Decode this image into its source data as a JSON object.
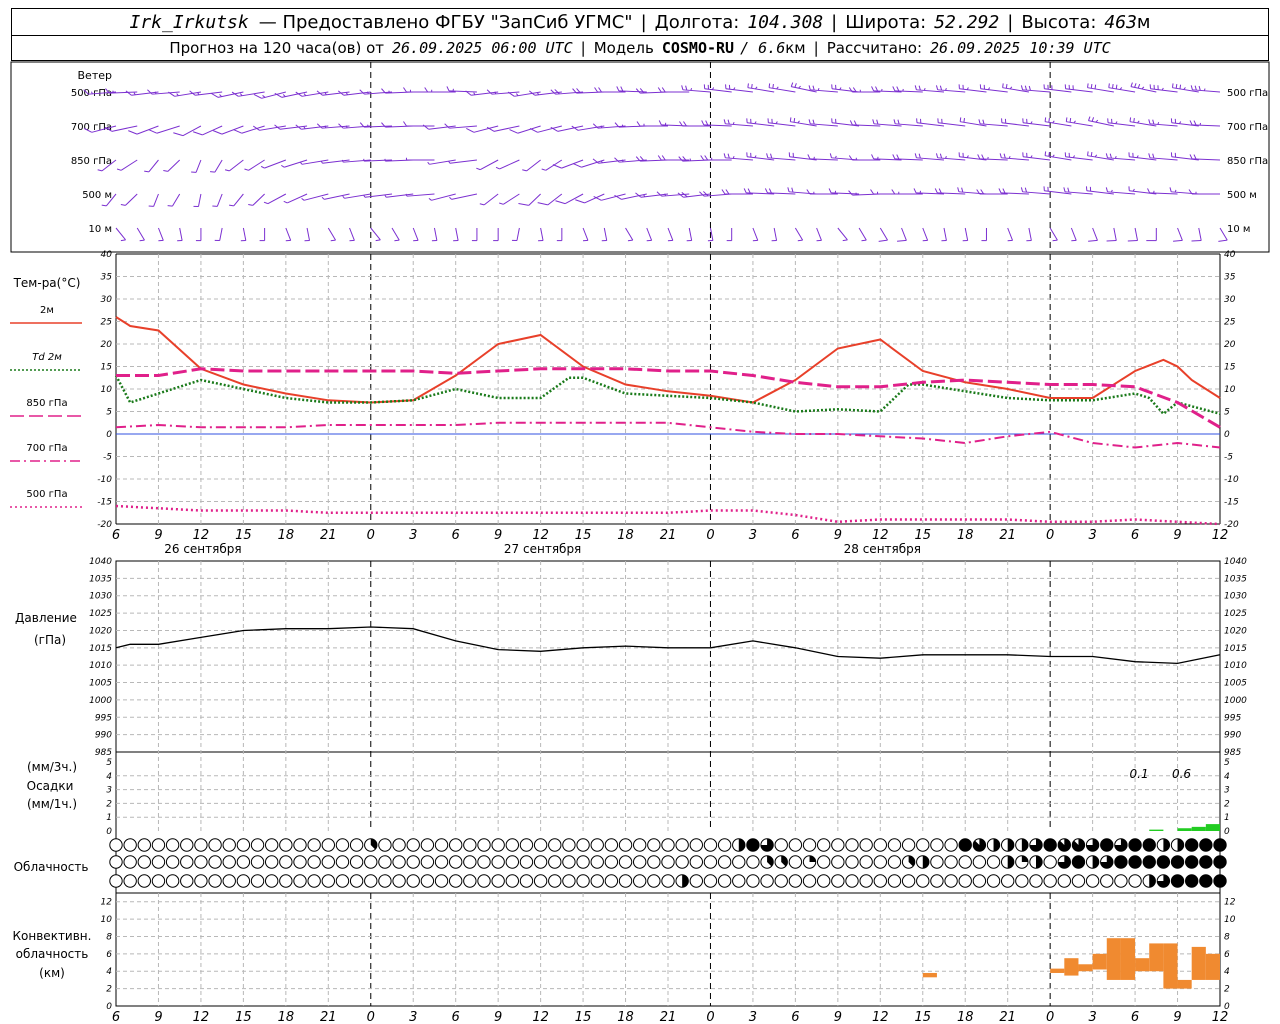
{
  "header": {
    "station": "Irk_Irkutsk",
    "provider": "— Предоставлено ФГБУ \"ЗапСиб УГМС\"",
    "lon_label": "Долгота:",
    "lon_value": "104.308",
    "lat_label": "Широта:",
    "lat_value": "52.292",
    "alt_label": "Высота:",
    "alt_value": "463",
    "alt_unit": "м",
    "forecast_label": "Прогноз на 120 часа(ов) от",
    "forecast_start": "26.09.2025 06:00 UTC",
    "model_label": "Модель",
    "model_name": "COSMO-RU",
    "model_res": "/ 6.6",
    "model_res_unit": "км",
    "calc_label": "Рассчитано:",
    "calc_time": "26.09.2025 10:39 UTC"
  },
  "wind": {
    "title": "Ветер",
    "levels": [
      "500 гПа",
      "700 гПа",
      "850 гПа",
      "500 м",
      "10  м"
    ],
    "barb_color": "#7b2fd0"
  },
  "colors": {
    "t2m": "#e8402a",
    "td2m": "#1a7a1a",
    "t850": "#e0208a",
    "t700": "#e0208a",
    "t500": "#e0208a",
    "pressure": "#000000",
    "precip": "#22cc22",
    "convective": "#f08a30",
    "zero_line": "#3050e0"
  },
  "chart_data": [
    {
      "type": "line",
      "title": "",
      "ylabel": "Тем-ра(°C)",
      "ylim": [
        -20,
        40
      ],
      "yticks": [
        -20,
        -15,
        -10,
        -5,
        0,
        5,
        10,
        15,
        20,
        25,
        30,
        35,
        40
      ],
      "x_hours": [
        0,
        3,
        6,
        9,
        12,
        15,
        18,
        21,
        24,
        27,
        30,
        33,
        36,
        39,
        42,
        45,
        48,
        51,
        54,
        57,
        60,
        63,
        66,
        69,
        72,
        75,
        78
      ],
      "series": [
        {
          "name": "2м",
          "style": "solid",
          "x": [
            0,
            1,
            3,
            6,
            9,
            12,
            15,
            18,
            21,
            24,
            27,
            30,
            33,
            36,
            39,
            42,
            45,
            48,
            51,
            54,
            57,
            60,
            63,
            66,
            69,
            72,
            74,
            75,
            76,
            78
          ],
          "y": [
            26,
            24,
            23,
            14.5,
            11,
            9,
            7.5,
            7,
            7.5,
            13,
            20,
            22,
            15,
            11,
            9.5,
            8.5,
            7,
            12,
            19,
            21,
            14,
            11.5,
            10,
            8,
            8,
            14,
            16.5,
            15,
            12,
            8
          ]
        },
        {
          "name": "Td  2м",
          "style": "dotted",
          "x": [
            0,
            1,
            3,
            6,
            9,
            12,
            15,
            18,
            21,
            24,
            27,
            30,
            32,
            33,
            36,
            39,
            42,
            45,
            48,
            51,
            54,
            56,
            57,
            60,
            63,
            66,
            69,
            72,
            73,
            74,
            75,
            78
          ],
          "y": [
            13,
            7,
            9,
            12,
            10,
            8,
            7,
            7,
            7.5,
            10,
            8,
            8,
            12.5,
            12.5,
            9,
            8.5,
            8,
            7,
            5,
            5.5,
            5,
            11,
            11,
            9.5,
            8,
            7.5,
            7.5,
            9,
            8,
            4.5,
            7,
            4.5
          ]
        },
        {
          "name": "850 гПа",
          "style": "longdash",
          "x": [
            0,
            3,
            6,
            9,
            12,
            15,
            18,
            21,
            24,
            27,
            30,
            33,
            36,
            39,
            42,
            45,
            48,
            51,
            54,
            57,
            60,
            63,
            66,
            69,
            72,
            75,
            78
          ],
          "y": [
            13,
            13,
            14.5,
            14,
            14,
            14,
            14,
            14,
            13.5,
            14,
            14.5,
            14.5,
            14.5,
            14,
            14,
            13,
            11.5,
            10.5,
            10.5,
            11.5,
            12,
            11.5,
            11,
            11,
            10.5,
            7,
            1.5
          ]
        },
        {
          "name": "700 гПа",
          "style": "dashdot",
          "x": [
            0,
            3,
            6,
            9,
            12,
            15,
            18,
            21,
            24,
            27,
            30,
            33,
            36,
            39,
            42,
            45,
            48,
            51,
            54,
            57,
            60,
            63,
            66,
            69,
            72,
            75,
            78
          ],
          "y": [
            1.5,
            2,
            1.5,
            1.5,
            1.5,
            2,
            2,
            2,
            2,
            2.5,
            2.5,
            2.5,
            2.5,
            2.5,
            1.5,
            0.5,
            0,
            0,
            -0.5,
            -1,
            -2,
            -0.5,
            0.5,
            -2,
            -3,
            -2,
            -3
          ]
        },
        {
          "name": "500 гПа",
          "style": "dot",
          "x": [
            0,
            3,
            6,
            9,
            12,
            15,
            18,
            21,
            24,
            27,
            30,
            33,
            36,
            39,
            42,
            45,
            48,
            51,
            54,
            57,
            60,
            63,
            66,
            69,
            72,
            75,
            78
          ],
          "y": [
            -16,
            -16.5,
            -17,
            -17,
            -17,
            -17.5,
            -17.5,
            -17.5,
            -17.5,
            -17.5,
            -17.5,
            -17.5,
            -17.5,
            -17.5,
            -17,
            -17,
            -18,
            -19.5,
            -19,
            -19,
            -19,
            -19,
            -19.5,
            -19.5,
            -19,
            -19.5,
            -20
          ]
        }
      ]
    },
    {
      "type": "line",
      "title": "",
      "ylabel": "Давление",
      "yunit": "(гПа)",
      "ylim": [
        985,
        1040
      ],
      "yticks": [
        985,
        990,
        995,
        1000,
        1005,
        1010,
        1015,
        1020,
        1025,
        1030,
        1035,
        1040
      ],
      "series": [
        {
          "name": "pressure",
          "x": [
            0,
            1,
            3,
            6,
            9,
            12,
            15,
            18,
            21,
            24,
            27,
            30,
            33,
            36,
            39,
            42,
            45,
            48,
            51,
            54,
            57,
            60,
            63,
            66,
            69,
            72,
            75,
            78
          ],
          "y": [
            1015,
            1016,
            1016,
            1018,
            1020,
            1020.5,
            1020.5,
            1021,
            1020.5,
            1017,
            1014.5,
            1014,
            1015,
            1015.5,
            1015,
            1015,
            1017,
            1015,
            1012.5,
            1012,
            1013,
            1013,
            1013,
            1012.5,
            1012.5,
            1011,
            1010.5,
            1013
          ]
        }
      ]
    },
    {
      "type": "bar",
      "title": "",
      "ylabel": "Осадки",
      "ylabel_top": "(мм/3ч.)",
      "ylabel_bottom": "(мм/1ч.)",
      "ylim": [
        0,
        5
      ],
      "yticks": [
        0,
        1,
        2,
        3,
        4,
        5
      ],
      "annotations": [
        {
          "x": 72,
          "text": "0.1"
        },
        {
          "x": 75,
          "text": "0.6"
        }
      ],
      "bars": [
        {
          "x0": 73,
          "x1": 74,
          "y": 0.1
        },
        {
          "x0": 75,
          "x1": 76,
          "y": 0.2
        },
        {
          "x0": 76,
          "x1": 77,
          "y": 0.3
        },
        {
          "x0": 77,
          "x1": 78,
          "y": 0.5
        }
      ]
    },
    {
      "type": "table",
      "title": "",
      "ylabel": "Облачность",
      "rows": [
        {
          "name": "row1",
          "hour_step": 1,
          "cover_eighths": [
            [
              18,
              3
            ],
            [
              44,
              4
            ],
            [
              45,
              8
            ],
            [
              46,
              6
            ],
            [
              60,
              8
            ],
            [
              61,
              7
            ],
            [
              62,
              4
            ],
            [
              63,
              4
            ],
            [
              64,
              4
            ],
            [
              65,
              6
            ],
            [
              66,
              8
            ],
            [
              67,
              7
            ],
            [
              68,
              7
            ],
            [
              69,
              6
            ],
            [
              70,
              8
            ],
            [
              71,
              6
            ],
            [
              72,
              8
            ],
            [
              73,
              8
            ],
            [
              74,
              4
            ],
            [
              75,
              4
            ],
            [
              76,
              8
            ],
            [
              77,
              8
            ],
            [
              78,
              8
            ]
          ]
        },
        {
          "name": "row2",
          "hour_step": 1,
          "cover_eighths": [
            [
              46,
              3
            ],
            [
              47,
              3
            ],
            [
              49,
              2
            ],
            [
              56,
              3
            ],
            [
              57,
              4
            ],
            [
              63,
              4
            ],
            [
              64,
              2
            ],
            [
              65,
              4
            ],
            [
              67,
              6
            ],
            [
              68,
              8
            ],
            [
              69,
              4
            ],
            [
              70,
              6
            ],
            [
              71,
              8
            ],
            [
              72,
              8
            ],
            [
              73,
              8
            ],
            [
              74,
              8
            ],
            [
              75,
              8
            ],
            [
              76,
              8
            ],
            [
              77,
              8
            ],
            [
              78,
              8
            ]
          ]
        },
        {
          "name": "row3",
          "hour_step": 1,
          "cover_eighths": [
            [
              40,
              4
            ],
            [
              73,
              4
            ],
            [
              74,
              6
            ],
            [
              75,
              8
            ],
            [
              76,
              8
            ],
            [
              77,
              8
            ],
            [
              78,
              8
            ]
          ]
        }
      ]
    },
    {
      "type": "bar",
      "title": "",
      "ylabel": "Конвективн. облачность (км)",
      "ylabel_lines": [
        "Конвективн.",
        "облачность",
        "(км)"
      ],
      "ylim": [
        0,
        13
      ],
      "yticks": [
        0,
        2,
        4,
        6,
        8,
        10,
        12
      ],
      "ranges": [
        {
          "x0": 57,
          "x1": 58,
          "low": 3.3,
          "high": 3.8
        },
        {
          "x0": 66,
          "x1": 67,
          "low": 3.8,
          "high": 4.3
        },
        {
          "x0": 67,
          "x1": 68,
          "low": 3.5,
          "high": 5.5
        },
        {
          "x0": 68,
          "x1": 69,
          "low": 4.0,
          "high": 4.8
        },
        {
          "x0": 69,
          "x1": 70,
          "low": 4.2,
          "high": 6.0
        },
        {
          "x0": 70,
          "x1": 71,
          "low": 3.0,
          "high": 7.8
        },
        {
          "x0": 71,
          "x1": 72,
          "low": 3.0,
          "high": 7.8
        },
        {
          "x0": 72,
          "x1": 73,
          "low": 4.0,
          "high": 5.5
        },
        {
          "x0": 73,
          "x1": 74,
          "low": 4.0,
          "high": 7.2
        },
        {
          "x0": 74,
          "x1": 75,
          "low": 2.0,
          "high": 7.2
        },
        {
          "x0": 75,
          "x1": 76,
          "low": 2.0,
          "high": 3.0
        },
        {
          "x0": 76,
          "x1": 77,
          "low": 3.0,
          "high": 6.8
        },
        {
          "x0": 77,
          "x1": 78,
          "low": 3.0,
          "high": 6.0
        }
      ]
    }
  ],
  "time_axis": {
    "tick_labels": [
      "6",
      "9",
      "12",
      "15",
      "18",
      "21",
      "0",
      "3",
      "6",
      "9",
      "12",
      "15",
      "18",
      "21",
      "0",
      "3",
      "6",
      "9",
      "12",
      "15",
      "18",
      "21",
      "0",
      "3",
      "6",
      "9",
      "12"
    ],
    "dates": [
      {
        "x": 6,
        "text": "26 сентября"
      },
      {
        "x": 30,
        "text": "27 сентября"
      },
      {
        "x": 54,
        "text": "28 сентября"
      }
    ],
    "midnights": [
      18,
      42,
      66
    ]
  }
}
